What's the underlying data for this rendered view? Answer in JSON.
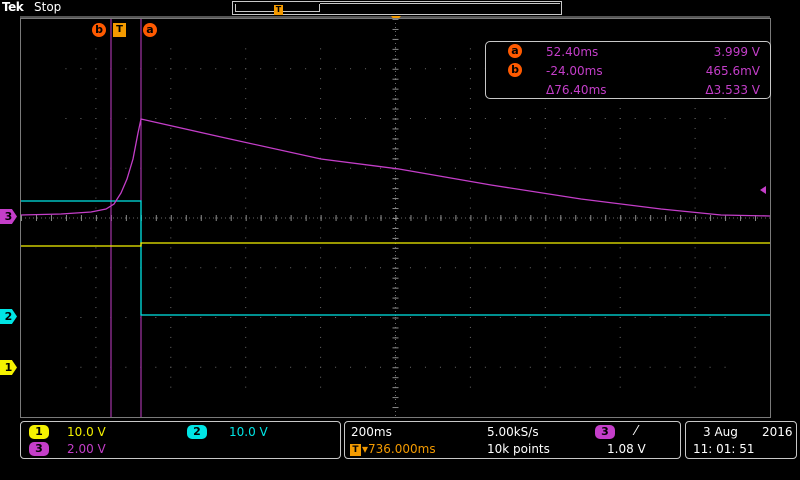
{
  "header": {
    "brand": "Tek",
    "run_state": "Stop",
    "record_trigger_icon": "T"
  },
  "markers": {
    "cursor_b": "b",
    "cursor_a": "a",
    "trigger": "T",
    "ch3_ground": "3",
    "ch2_ground": "2",
    "ch1_ground": "1"
  },
  "cursor_readout": {
    "a_tag": "a",
    "a_time": "52.40ms",
    "a_volt": "3.999 V",
    "b_tag": "b",
    "b_time": "-24.00ms",
    "b_volt": "465.6mV",
    "delta_time": "Δ76.40ms",
    "delta_volt": "Δ3.533 V"
  },
  "channels": {
    "ch1": {
      "tag": "1",
      "scale": "10.0 V",
      "color": "#f5f200"
    },
    "ch2": {
      "tag": "2",
      "scale": "10.0 V",
      "color": "#00e5e5"
    },
    "ch3": {
      "tag": "3",
      "scale": "2.00 V",
      "color": "#c43ec9"
    }
  },
  "timebase": {
    "horizontal_scale": "200ms",
    "trigger_position_icon": "T",
    "trigger_position": "▾736.000ms",
    "sample_rate": "5.00kS/s",
    "record_length": "10k points",
    "trigger_source": "3",
    "trigger_slope_icon": "rising-edge-icon",
    "trigger_slope": "⁄",
    "trigger_level": "1.08 V"
  },
  "datetime": {
    "date_day_month": "3 Aug",
    "date_year": "2016",
    "time": "11: 01: 51"
  },
  "colors": {
    "ch1": "#f5f200",
    "ch2": "#00e5e5",
    "ch3": "#c43ec9",
    "cursor": "#c43ec9",
    "trigger": "#f39a00",
    "cursor_tag": "#ff5a00"
  }
}
